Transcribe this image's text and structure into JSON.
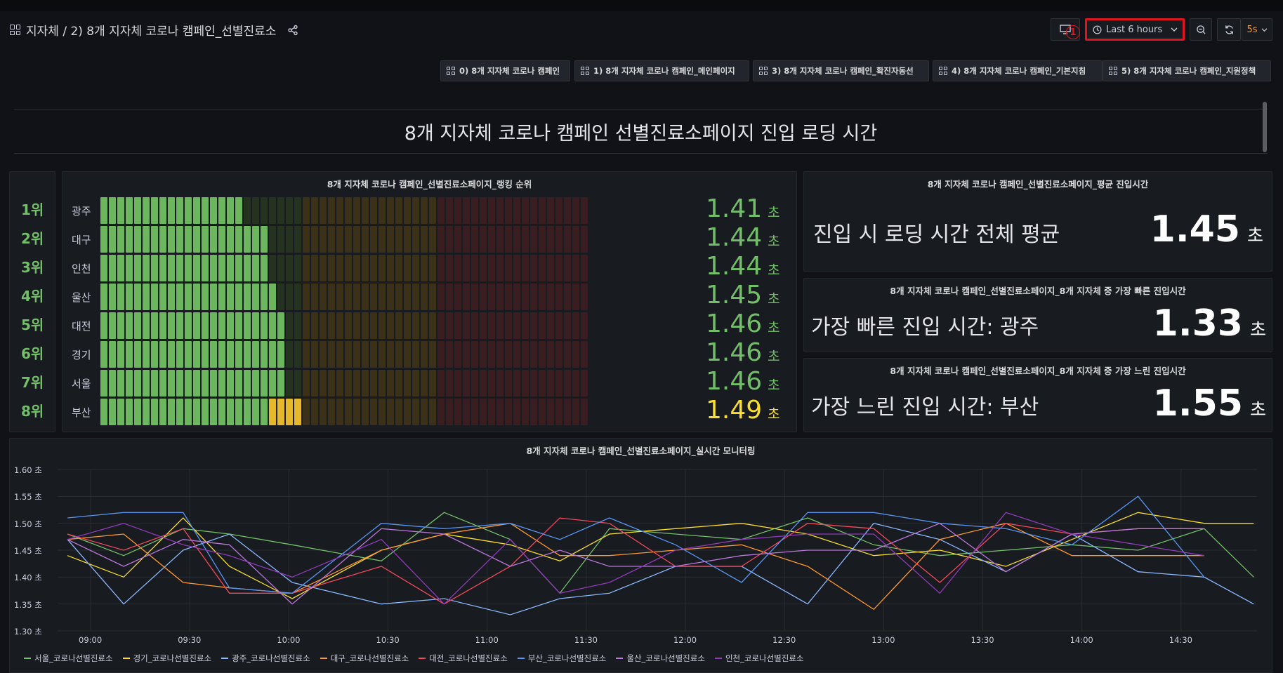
{
  "header": {
    "title": "지자체 / 2) 8개 지자체 코로나 캠페인_선별진료소",
    "badge": "1",
    "time_range": "Last 6 hours",
    "refresh": "5s"
  },
  "dashboard_links": [
    "0) 8개 지자체 코로나 캠페인",
    "1) 8개 지자체 코로나 캠페인_메인페이지",
    "3) 8개 지자체 코로나 캠페인_확진자동선",
    "4) 8개 지자체 코로나 캠페인_기본지침",
    "5) 8개 지자체 코로나 캠페인_지원정책"
  ],
  "text_panel": {
    "title": "8개 지자체 코로나 캠페인 선별진료소페이지 진입 로딩 시간"
  },
  "ranking": {
    "title": "8개 지자체 코로나 캠페인_선별진료소페이지_랭킹 순위",
    "unit": "초",
    "rows": [
      {
        "rank": "1위",
        "city": "광주",
        "value": "1.41",
        "filled": 17,
        "color": "#73bf69"
      },
      {
        "rank": "2위",
        "city": "대구",
        "value": "1.44",
        "filled": 20,
        "color": "#73bf69"
      },
      {
        "rank": "3위",
        "city": "인천",
        "value": "1.44",
        "filled": 20,
        "color": "#73bf69"
      },
      {
        "rank": "4위",
        "city": "울산",
        "value": "1.45",
        "filled": 21,
        "color": "#73bf69"
      },
      {
        "rank": "5위",
        "city": "대전",
        "value": "1.46",
        "filled": 22,
        "color": "#73bf69"
      },
      {
        "rank": "6위",
        "city": "경기",
        "value": "1.46",
        "filled": 22,
        "color": "#73bf69"
      },
      {
        "rank": "7위",
        "city": "서울",
        "value": "1.46",
        "filled": 22,
        "color": "#73bf69"
      },
      {
        "rank": "8위",
        "city": "부산",
        "value": "1.49",
        "filled": 24,
        "color": "#fade2a"
      }
    ]
  },
  "stats": [
    {
      "title": "8개 지자체 코로나 캠페인_선별진료소페이지_평균 진입시간",
      "label": "진입 시 로딩 시간 전체 평균",
      "value": "1.45",
      "unit": "초"
    },
    {
      "title": "8개 지자체 코로나 캠페인_선별진료소페이지_8개 지자체 중 가장 빠른 진입시간",
      "label": "가장 빠른 진입 시간: 광주",
      "value": "1.33",
      "unit": "초"
    },
    {
      "title": "8개 지자체 코로나 캠페인_선별진료소페이지_8개 지자체 중 가장 느린 진입시간",
      "label": "가장 느린 진입 시간: 부산",
      "value": "1.55",
      "unit": "초"
    }
  ],
  "chart_data": {
    "type": "line",
    "title": "8개 지자체 코로나 캠페인_선별진료소페이지_실시간 모니터링",
    "y_ticks": [
      "1.60 초",
      "1.55 초",
      "1.50 초",
      "1.45 초",
      "1.40 초",
      "1.35 초",
      "1.30 초"
    ],
    "ylim": [
      1.3,
      1.6
    ],
    "xlim": [
      "08:50",
      "14:53"
    ],
    "x_ticks": [
      "09:00",
      "09:30",
      "10:00",
      "10:30",
      "11:00",
      "11:30",
      "12:00",
      "12:30",
      "13:00",
      "13:30",
      "14:00",
      "14:30"
    ],
    "x": [
      "08:53",
      "09:10",
      "09:28",
      "09:42",
      "10:01",
      "10:28",
      "10:47",
      "11:07",
      "11:22",
      "11:37",
      "11:57",
      "12:17",
      "12:37",
      "12:57",
      "13:17",
      "13:37",
      "13:57",
      "14:17",
      "14:37",
      "14:52"
    ],
    "series": [
      {
        "name": "서울_코로나선별진료소",
        "color": "#73bf69",
        "values": [
          1.48,
          1.44,
          1.49,
          1.48,
          1.46,
          1.43,
          1.52,
          1.47,
          1.37,
          1.49,
          1.48,
          1.47,
          1.51,
          1.46,
          1.44,
          1.45,
          1.46,
          1.45,
          1.49,
          1.4
        ]
      },
      {
        "name": "경기_코로나선별진료소",
        "color": "#fade2a",
        "values": [
          1.44,
          1.4,
          1.51,
          1.42,
          1.36,
          1.45,
          1.48,
          1.46,
          1.43,
          1.48,
          1.49,
          1.5,
          1.48,
          1.44,
          1.45,
          1.42,
          1.47,
          1.52,
          1.5,
          1.5
        ]
      },
      {
        "name": "광주_코로나선별진료소",
        "color": "#8ab8ff",
        "values": [
          1.47,
          1.35,
          1.45,
          1.48,
          1.39,
          1.35,
          1.36,
          1.33,
          1.36,
          1.37,
          1.42,
          1.42,
          1.35,
          1.5,
          1.47,
          1.41,
          1.48,
          1.41,
          1.4,
          1.35
        ]
      },
      {
        "name": "대구_코로나선별진료소",
        "color": "#ff9830",
        "values": [
          1.47,
          1.48,
          1.39,
          1.38,
          1.37,
          1.45,
          1.48,
          1.5,
          1.44,
          1.44,
          1.45,
          1.46,
          1.42,
          1.34,
          1.47,
          1.5,
          1.44,
          1.44,
          1.44,
          null
        ]
      },
      {
        "name": "대전_코로나선별진료소",
        "color": "#f2495c",
        "values": [
          1.48,
          1.45,
          1.49,
          1.37,
          1.37,
          1.42,
          1.35,
          1.42,
          1.51,
          1.5,
          1.42,
          1.42,
          1.5,
          1.49,
          1.39,
          1.5,
          1.48,
          1.49,
          1.49,
          null
        ]
      },
      {
        "name": "부산_코로나선별진료소",
        "color": "#5794f2",
        "values": [
          1.51,
          1.52,
          1.52,
          1.38,
          1.37,
          1.5,
          1.49,
          1.5,
          1.47,
          1.51,
          1.46,
          1.39,
          1.52,
          1.52,
          1.5,
          1.49,
          1.46,
          1.55,
          1.4,
          null
        ]
      },
      {
        "name": "울산_코로나선별진료소",
        "color": "#b877d9",
        "values": [
          1.47,
          1.42,
          1.47,
          1.46,
          1.35,
          1.49,
          1.48,
          1.42,
          1.45,
          1.42,
          1.42,
          1.44,
          1.45,
          1.45,
          1.5,
          1.41,
          1.48,
          1.49,
          1.49,
          null
        ]
      },
      {
        "name": "인천_코로나선별진료소",
        "color": "#8f3bb8",
        "values": [
          1.47,
          1.5,
          1.46,
          1.44,
          1.4,
          1.47,
          1.35,
          1.47,
          1.37,
          1.39,
          1.45,
          1.47,
          1.48,
          1.48,
          1.37,
          1.52,
          1.48,
          1.46,
          1.44,
          null
        ]
      }
    ]
  }
}
